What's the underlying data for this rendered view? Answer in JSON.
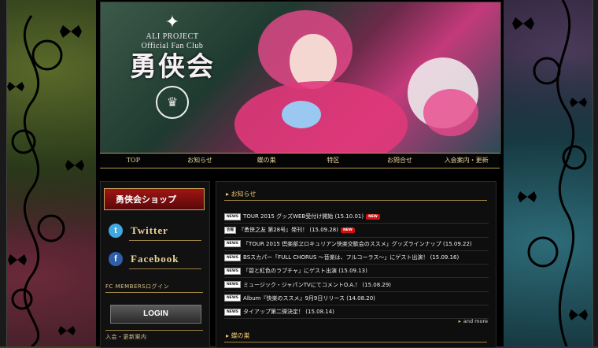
{
  "banner": {
    "logo_line1": "ALI PROJECT",
    "logo_line2": "Official Fan Club",
    "logo_title": "勇侠会"
  },
  "nav": {
    "items": [
      "TOP",
      "お知らせ",
      "蝶の巣",
      "特区",
      "お問合せ",
      "入会案内・更新"
    ]
  },
  "sidebar": {
    "shop_label": "勇侠会ショップ",
    "twitter_label": "Twitter",
    "facebook_label": "Facebook",
    "login_section_title": "FC MEMBERSログイン",
    "login_button": "LOGIN",
    "join_section_title": "入会・更新案内"
  },
  "news": {
    "heading": "お知らせ",
    "items": [
      {
        "tag": "NEWS",
        "text": "TOUR 2015 グッズWEB受付け開始 (15.10.01)",
        "new": true
      },
      {
        "tag": "会報",
        "text": "『勇侠之友 第28号』発刊！ (15.09.28)",
        "new": true
      },
      {
        "tag": "NEWS",
        "text": "「TOUR 2015 倶楽部ヱロキュリアン快楽交歓会のススメ」グッズラインナップ (15.09.22)",
        "new": false
      },
      {
        "tag": "NEWS",
        "text": "BSスカパー「FULL CHORUS ～音楽は、フルコーラス～」にゲスト出演！ (15.09.16)",
        "new": false
      },
      {
        "tag": "NEWS",
        "text": "「碧と紅色のラプチャ」にゲスト出演 (15.09.13)",
        "new": false
      },
      {
        "tag": "NEWS",
        "text": "ミュージック・ジャパンTVにてコメントO.A.！ (15.08.29)",
        "new": false
      },
      {
        "tag": "NEWS",
        "text": "Album『快楽のススメ』9月9日リリース (14.08.20)",
        "new": false
      },
      {
        "tag": "NEWS",
        "text": "タイアップ第二弾決定！ (15.08.14)",
        "new": false
      }
    ],
    "more_label": "and more",
    "sub_heading": "蝶の巣"
  },
  "colors": {
    "accent_gold": "#e8c66a",
    "shop_red": "#a01515",
    "twitter_blue": "#3fa9e0",
    "facebook_blue": "#2f5fa8"
  }
}
